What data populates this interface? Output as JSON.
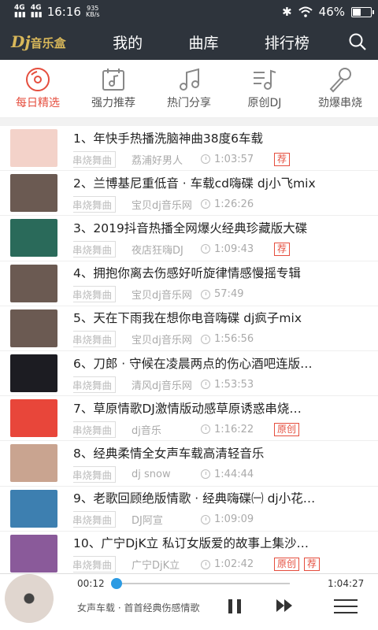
{
  "status": {
    "signal1": "4G",
    "signal2": "4G",
    "time": "16:16",
    "speed": "935",
    "speed_unit": "KB/s",
    "battery": "46%",
    "battery_level": 0.46
  },
  "header": {
    "logo": "Dj",
    "logo_sub": "音乐盒",
    "tabs": [
      "我的",
      "曲库",
      "排行榜"
    ]
  },
  "categories": [
    {
      "label": "每日精选",
      "icon": "disc-icon",
      "active": true
    },
    {
      "label": "强力推荐",
      "icon": "calendar-music-icon",
      "active": false
    },
    {
      "label": "热门分享",
      "icon": "music-note-icon",
      "active": false
    },
    {
      "label": "原创DJ",
      "icon": "music-list-icon",
      "active": false
    },
    {
      "label": "劲爆串烧",
      "icon": "microphone-icon",
      "active": false
    }
  ],
  "songs": [
    {
      "title": "1、年快手热播洗脑神曲38度6车载",
      "genre": "串烧舞曲",
      "uploader": "荔浦好男人",
      "duration": "1:03:57",
      "tags": [
        "荐"
      ],
      "thumb": "#f3d2c9"
    },
    {
      "title": "2、兰博基尼重低音 · 车载cd嗨碟 dj小飞mix",
      "genre": "串烧舞曲",
      "uploader": "宝贝dj音乐网",
      "duration": "1:26:26",
      "tags": [],
      "thumb": "#6b5a52"
    },
    {
      "title": "3、2019抖音热播全网爆火经典珍藏版大碟",
      "genre": "串烧舞曲",
      "uploader": "夜店狂嗨DJ",
      "duration": "1:09:43",
      "tags": [
        "荐"
      ],
      "thumb": "#2a6a5a"
    },
    {
      "title": "4、拥抱你离去伤感好听旋律情感慢摇专辑",
      "genre": "串烧舞曲",
      "uploader": "宝贝dj音乐网",
      "duration": "57:49",
      "tags": [],
      "thumb": "#6b5a52"
    },
    {
      "title": "5、天在下雨我在想你电音嗨碟 dj疯子mix",
      "genre": "串烧舞曲",
      "uploader": "宝贝dj音乐网",
      "duration": "1:56:56",
      "tags": [],
      "thumb": "#6b5a52"
    },
    {
      "title": "6、刀郎 · 守候在凌晨两点的伤心酒吧连版…",
      "genre": "串烧舞曲",
      "uploader": "清风dj音乐网",
      "duration": "1:53:53",
      "tags": [],
      "thumb": "#1c1c22"
    },
    {
      "title": "7、草原情歌DJ激情版动感草原诱惑串烧…",
      "genre": "串烧舞曲",
      "uploader": "dj音乐",
      "duration": "1:16:22",
      "tags": [
        "原创"
      ],
      "thumb": "#e8463a"
    },
    {
      "title": "8、经典柔情全女声车载高清轻音乐",
      "genre": "串烧舞曲",
      "uploader": "dj snow",
      "duration": "1:44:44",
      "tags": [],
      "thumb": "#c9a490"
    },
    {
      "title": "9、老歌回顾绝版情歌 · 经典嗨碟㈠ dj小花…",
      "genre": "串烧舞曲",
      "uploader": "DJ阿宣",
      "duration": "1:09:09",
      "tags": [],
      "thumb": "#3d7fb0"
    },
    {
      "title": "10、广宁DjK立 私订女版爱的故事上集沙…",
      "genre": "串烧舞曲",
      "uploader": "广宁DjK立",
      "duration": "1:02:42",
      "tags": [
        "原创",
        "荐"
      ],
      "thumb": "#8a5a9a"
    }
  ],
  "player": {
    "current": "00:12",
    "total": "1:04:27",
    "progress": 0.003,
    "track": "女声车载 · 首首经典伤感情歌"
  },
  "colors": {
    "accent": "#e54e3e",
    "header_bg": "#2e343c",
    "progress": "#2c9be3"
  }
}
